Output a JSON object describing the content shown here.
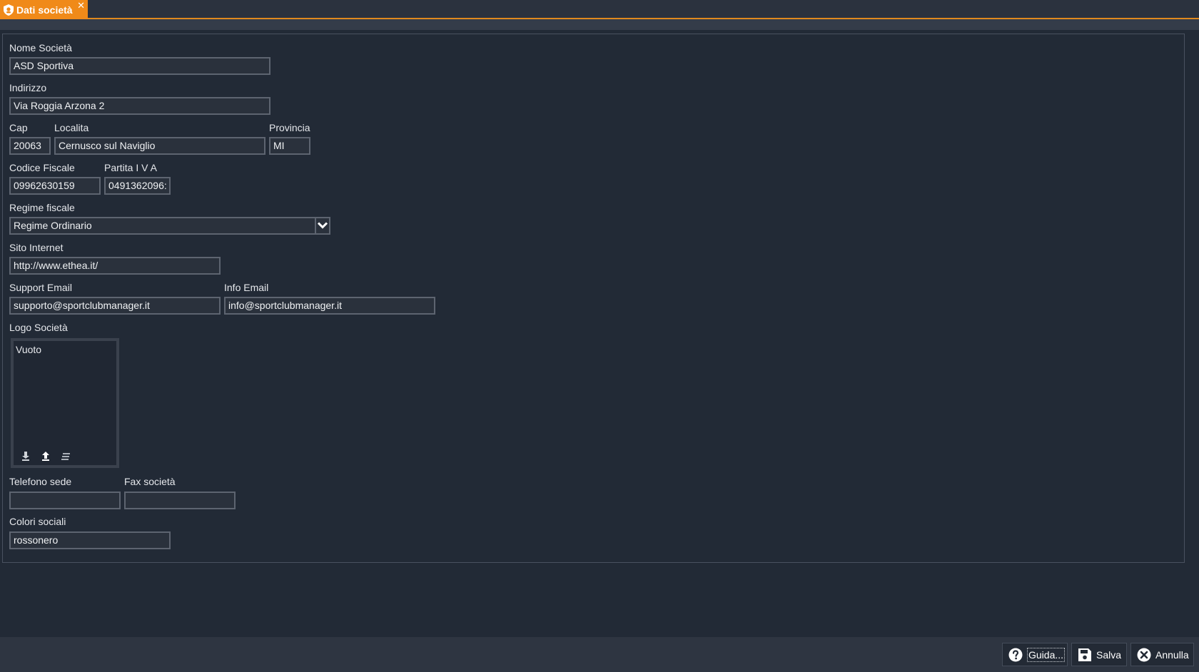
{
  "tab": {
    "title": "Dati società",
    "close": "✕"
  },
  "form": {
    "nome_societa": {
      "label": "Nome Società",
      "value": "ASD Sportiva"
    },
    "indirizzo": {
      "label": "Indirizzo",
      "value": "Via Roggia Arzona 2"
    },
    "cap": {
      "label": "Cap",
      "value": "20063"
    },
    "localita": {
      "label": "Localita",
      "value": "Cernusco sul Naviglio"
    },
    "provincia": {
      "label": "Provincia",
      "value": "MI"
    },
    "codice_fiscale": {
      "label": "Codice Fiscale",
      "value": "09962630159"
    },
    "partita_iva": {
      "label": "Partita I V A",
      "value": "0491362096:"
    },
    "regime_fiscale": {
      "label": "Regime fiscale",
      "value": "Regime Ordinario"
    },
    "sito_internet": {
      "label": "Sito Internet",
      "value": "http://www.ethea.it/"
    },
    "support_email": {
      "label": "Support Email",
      "value": "supporto@sportclubmanager.it"
    },
    "info_email": {
      "label": "Info Email",
      "value": "info@sportclubmanager.it"
    },
    "logo": {
      "label": "Logo Società",
      "value": "Vuoto"
    },
    "telefono": {
      "label": "Telefono sede",
      "value": ""
    },
    "fax": {
      "label": "Fax società",
      "value": ""
    },
    "colori": {
      "label": "Colori sociali",
      "value": "rossonero"
    }
  },
  "buttons": {
    "guida": "Guida...",
    "salva": "Salva",
    "annulla": "Annulla"
  },
  "colors": {
    "accent": "#f08a19",
    "background": "#222a36"
  }
}
